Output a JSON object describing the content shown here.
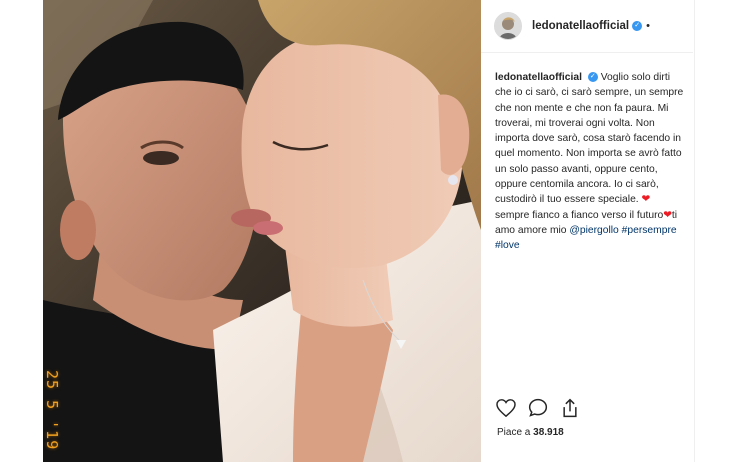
{
  "post": {
    "username": "ledonatellaofficial",
    "verified_mark": "✓",
    "separator": "•",
    "caption": {
      "username": "ledonatellaofficial",
      "line1": "Voglio solo dirti che io ci sarò, ci sarò sempre, un sempre che non mente e che non fa paura. Mi troverai, mi troverai ogni volta. Non importa dove sarò, cosa starò facendo in quel momento. Non importa se avrò fatto un solo passo avanti, oppure cento, oppure centomila ancora. Io ci sarò, custodirò il tuo essere speciale.",
      "heart1": "❤",
      "line2": " sempre fianco a fianco verso il futuro",
      "heart2": "❤",
      "line3": "ti amo amore mio ",
      "mention": "@piergollo",
      "hashtag1": "#persempre",
      "hashtag2": "#love"
    },
    "photo_timestamp": "25 5 '19",
    "likes_prefix": "Piace a",
    "likes_count": "38.918"
  },
  "icons": {
    "like": "heart-outline-icon",
    "comment": "speech-bubble-icon",
    "share": "share-icon"
  },
  "colors": {
    "link": "#003569",
    "verified": "#3897f0",
    "heart": "#ed1c24",
    "stamp": "#f0a020"
  }
}
